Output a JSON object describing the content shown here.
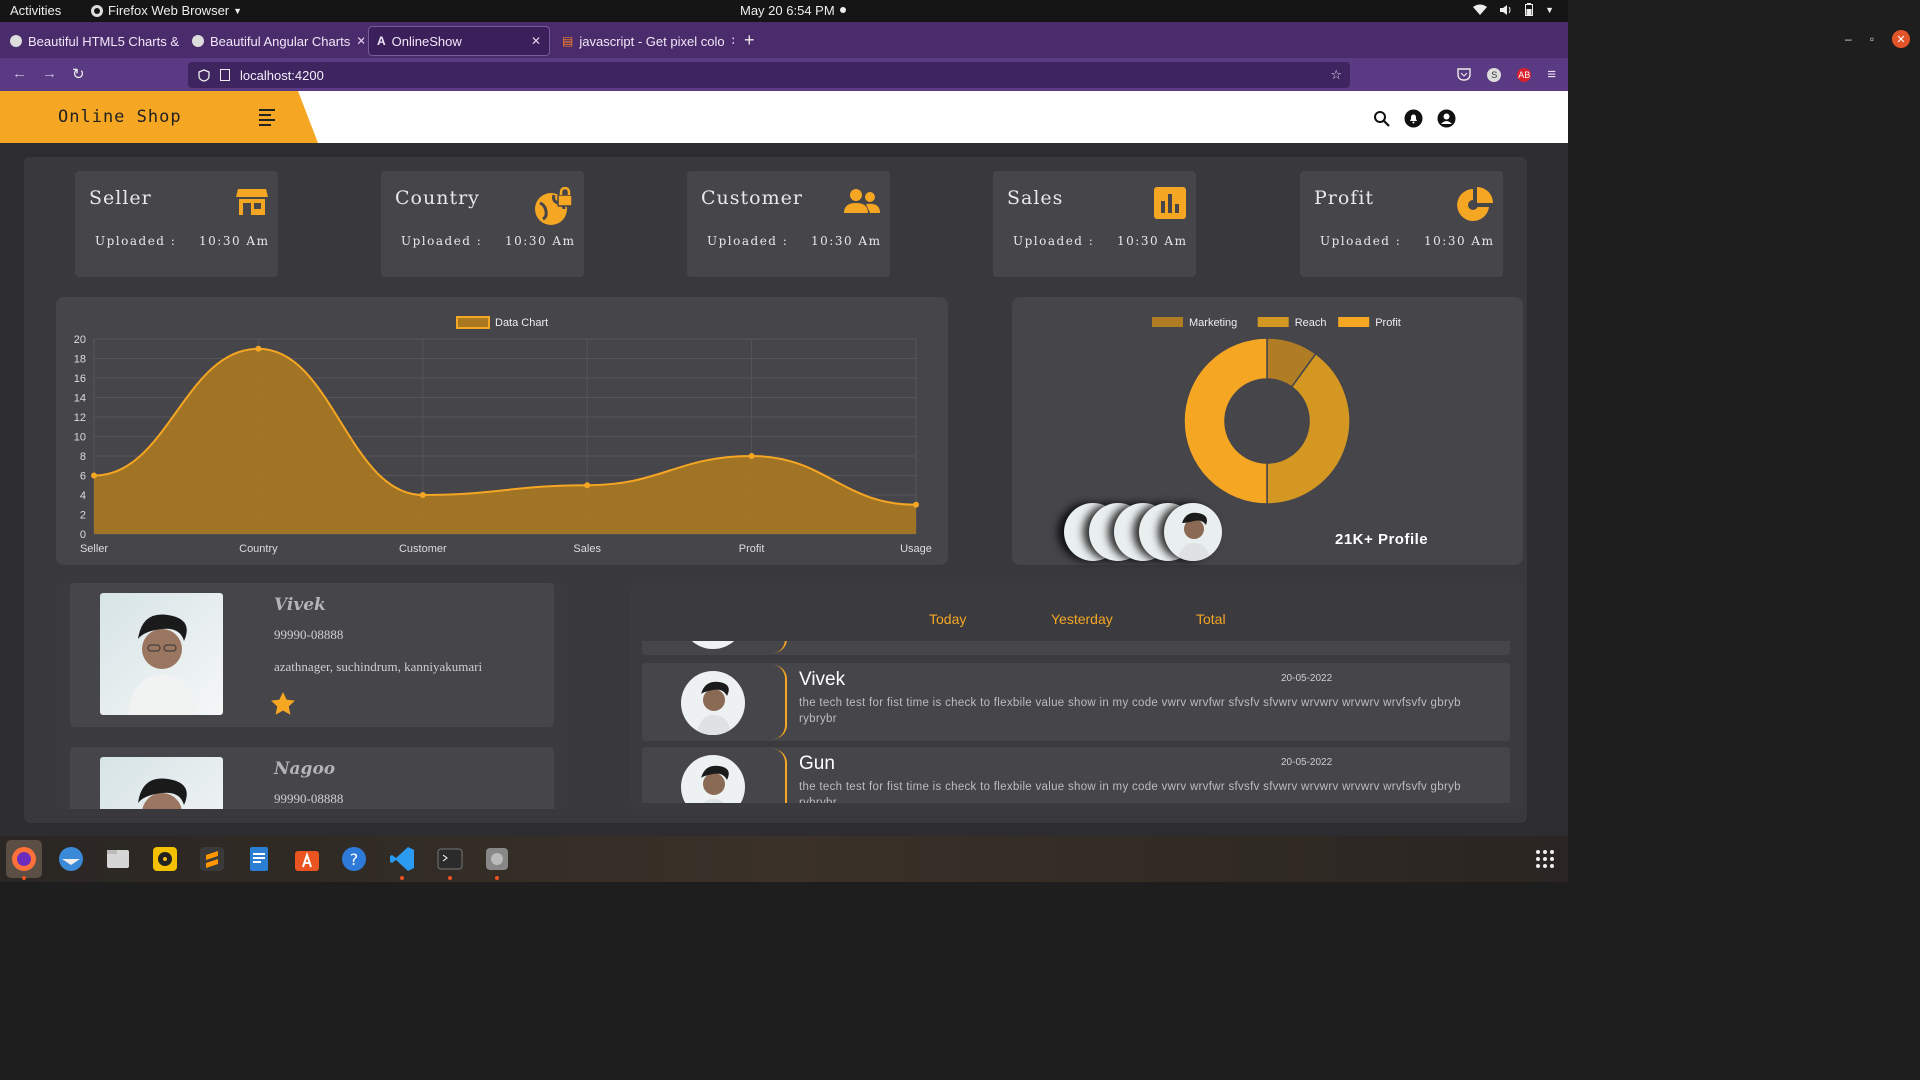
{
  "system": {
    "activities": "Activities",
    "app_name": "Firefox Web Browser",
    "clock": "May 20  6:54 PM"
  },
  "browser": {
    "tabs": [
      {
        "label": "Beautiful HTML5 Charts &",
        "active": false
      },
      {
        "label": "Beautiful Angular Charts",
        "active": false
      },
      {
        "label": "OnlineShow",
        "active": true
      },
      {
        "label": "javascript - Get pixel colo",
        "active": false
      }
    ],
    "url": "localhost:4200"
  },
  "app": {
    "brand": "Online Shop",
    "stats": [
      {
        "title": "Seller",
        "uploaded_label": "Uploaded :",
        "time": "10:30 Am",
        "icon": "store-icon"
      },
      {
        "title": "Country",
        "uploaded_label": "Uploaded :",
        "time": "10:30 Am",
        "icon": "globe-lock-icon"
      },
      {
        "title": "Customer",
        "uploaded_label": "Uploaded :",
        "time": "10:30 Am",
        "icon": "users-icon"
      },
      {
        "title": "Sales",
        "uploaded_label": "Uploaded :",
        "time": "10:30 Am",
        "icon": "bar-chart-icon"
      },
      {
        "title": "Profit",
        "uploaded_label": "Uploaded :",
        "time": "10:30 Am",
        "icon": "pie-chart-icon"
      }
    ],
    "profile_count": "21K+ Profile",
    "people": [
      {
        "name": "Vivek",
        "phone": "99990-08888",
        "address": "azathnager, suchindrum, kanniyakumari"
      },
      {
        "name": "Nagoo",
        "phone": "99990-08888"
      }
    ],
    "feed_tabs": [
      "Today",
      "Yesterday",
      "Total"
    ],
    "feed": [
      {
        "name": "Vivek",
        "date": "20-05-2022",
        "text": "the tech test for fist time is check to flexbile value show in my code vwrv wrvfwr sfvsfv sfvwrv wrvwrv wrvwrv wrvfsvfv gbryb rybrybr"
      },
      {
        "name": "Gun",
        "date": "20-05-2022",
        "text": "the tech test for fist time is check to flexbile value show in my code vwrv wrvfwr sfvsfv sfvwrv wrvwrv wrvwrv wrvfsvfv gbryb rybrybr"
      }
    ],
    "colors": {
      "accent": "#f5a623",
      "panel": "#38383d",
      "card": "#45454a"
    }
  },
  "chart_data": [
    {
      "type": "area",
      "categories": [
        "Seller",
        "Country",
        "Customer",
        "Sales",
        "Profit",
        "Usage"
      ],
      "series": [
        {
          "name": "Data Chart",
          "values": [
            6,
            19,
            4,
            5,
            8,
            3
          ]
        }
      ],
      "ylim": [
        0,
        20
      ],
      "yticks": [
        0,
        2,
        4,
        6,
        8,
        10,
        12,
        14,
        16,
        18,
        20
      ],
      "legend": "top-center",
      "grid": true,
      "color": "#f5a623"
    },
    {
      "type": "pie",
      "labels": [
        "Marketing",
        "Reach",
        "Profit"
      ],
      "values": [
        10,
        40,
        50
      ],
      "colors": [
        "#b07d24",
        "#d49722",
        "#f5a623"
      ],
      "legend": "top-center"
    }
  ]
}
